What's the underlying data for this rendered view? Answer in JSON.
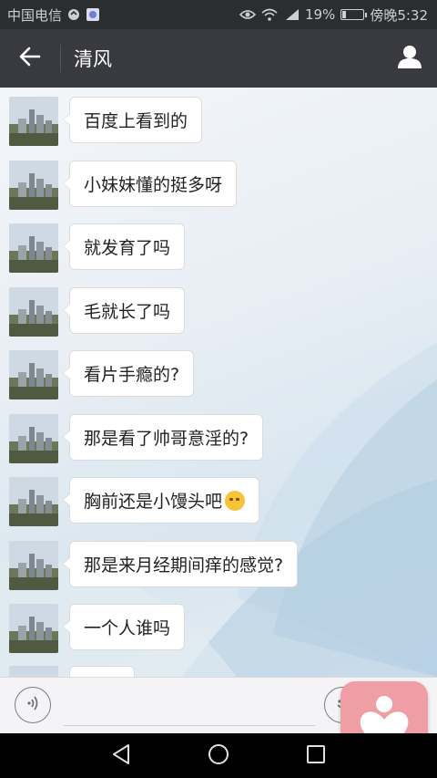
{
  "status_bar": {
    "carrier": "中国电信",
    "battery_level_text": "19%",
    "battery_fraction": 0.19,
    "time": "傍晚5:32"
  },
  "header": {
    "title": "清风"
  },
  "messages": [
    {
      "text": "百度上看到的"
    },
    {
      "text": "小妹妹懂的挺多呀"
    },
    {
      "text": "就发育了吗"
    },
    {
      "text": "毛就长了吗"
    },
    {
      "text": "看片手瘾的?"
    },
    {
      "text": "那是看了帅哥意淫的?"
    },
    {
      "text": "胸前还是小馒头吧",
      "emoji": "thinking-face"
    },
    {
      "text": "那是来月经期间痒的感觉?"
    },
    {
      "text": "一个人谁吗"
    }
  ],
  "input": {
    "placeholder": ""
  },
  "colors": {
    "title_bar": "#393a3f",
    "status_bar": "#2b2d31",
    "badge_pink": "#ee9ea4"
  }
}
